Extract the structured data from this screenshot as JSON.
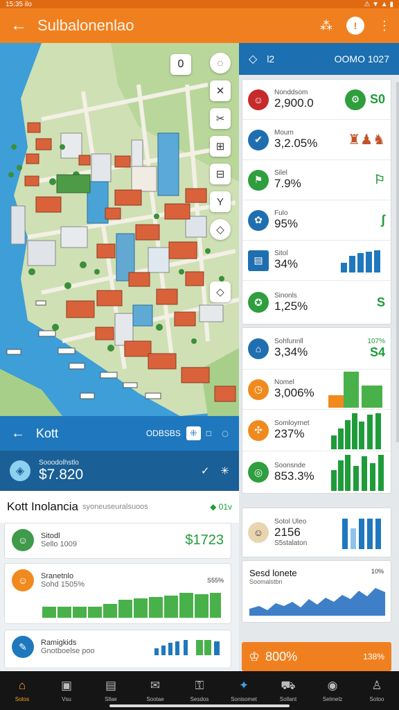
{
  "status": {
    "time": "15:35 ilo",
    "icons": "⚠ ▼ ▲ ▮"
  },
  "appbar": {
    "title": "Sulbalonenlao",
    "back_icon": "←",
    "share_icon": "⁂",
    "badge": "!",
    "menu_icon": "⋮"
  },
  "map": {
    "zoom_value": "0",
    "tools": [
      "◌",
      "✕",
      "✂",
      "⊞",
      "⊟",
      "Y",
      "◇",
      "◇"
    ]
  },
  "right_header": {
    "icon": "◇",
    "label": "l2",
    "code": "OOMO 1027"
  },
  "right_rows_a": [
    {
      "label": "Nonddsom",
      "value": "2,900.0",
      "side": "S0"
    },
    {
      "label": "Moum",
      "value": "3,2.05%",
      "side": ""
    },
    {
      "label": "Silel",
      "value": "7.9%",
      "side": "⚐"
    },
    {
      "label": "Fulo",
      "value": "95%",
      "side": "ʃ"
    },
    {
      "label": "Sitol",
      "value": "34%",
      "side": ""
    },
    {
      "label": "Sinonls",
      "value": "1,25%",
      "side": "S"
    }
  ],
  "right_rows_b": [
    {
      "label": "Sohfunnll",
      "value": "3,34%",
      "side": "S4",
      "pct": "107%"
    },
    {
      "label": "Nomel",
      "value": "3,006%",
      "side": ""
    },
    {
      "label": "Somloyrnet",
      "value": "237%",
      "side": ""
    },
    {
      "label": "Soonsnde",
      "value": "853.3%",
      "side": ""
    }
  ],
  "right_rows_c": [
    {
      "label": "Sotol Uleo",
      "value": "2156",
      "sub": "S5stalaton"
    }
  ],
  "right_chart": {
    "title": "Sesd lonete",
    "sub": "Soomalstbn",
    "pct": "10%"
  },
  "right_promo": {
    "value": "800%",
    "pct": "138%"
  },
  "kott": {
    "back_icon": "←",
    "title": "Kott",
    "code": "ODBSBS",
    "chip": "⁜",
    "sub": "□",
    "right_icon": "◌"
  },
  "balance": {
    "label": "Sooodolhstlo",
    "value": "$7.820"
  },
  "klist": {
    "title": "Kott Inolancia",
    "subtitle": "syoneuseuralsuoos",
    "filter": "◆ 01v",
    "cards": [
      {
        "label": "Sitodl",
        "value": "Sello 1009",
        "amount": "$1723"
      },
      {
        "label": "Sranetnlo",
        "value": "Sohd 1505%",
        "chart_label": "S55%"
      },
      {
        "label": "Ramigkids",
        "value": "Gnotboelse poo",
        "amount": ""
      }
    ]
  },
  "navbar": [
    {
      "icon": "⌂",
      "label": "Sotos"
    },
    {
      "icon": "▣",
      "label": "Vsu"
    },
    {
      "icon": "▤",
      "label": "Sllae"
    },
    {
      "icon": "✉",
      "label": "Sootae"
    },
    {
      "icon": "⚿",
      "label": "Sesdos"
    },
    {
      "icon": "✦",
      "label": "Sonisomet"
    },
    {
      "icon": "⛟",
      "label": "Sollant"
    },
    {
      "icon": "◉",
      "label": "Selmelz"
    },
    {
      "icon": "♙",
      "label": "Sotoo"
    }
  ],
  "colors": {
    "brand": "#f0801f",
    "blue": "#1c6fb0",
    "green": "#1e9c3a"
  }
}
